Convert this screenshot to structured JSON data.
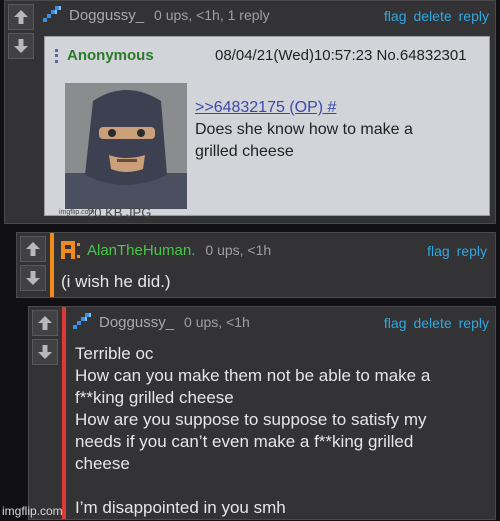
{
  "colors": {
    "background": "#111113",
    "panel": "#333335",
    "link": "#2fa8e2",
    "alan_name": "#47c74a",
    "orange_stripe": "#f18a1a",
    "red_stripe": "#e03838",
    "chan_bg": "#d2d4da"
  },
  "comments": [
    {
      "username": "Doggussy_",
      "meta": "0 ups, <1h, 1 reply",
      "actions": [
        "flag",
        "delete",
        "reply"
      ],
      "avatar_icon": "blue-pixel-avatar-icon",
      "image": {
        "poster": "Anonymous",
        "datetime": "08/04/21(Wed)10:57:23 No.64832301",
        "quote_link": ">>64832175 (OP) #",
        "reply_lines": [
          "Does she know how to make a",
          "grilled cheese"
        ],
        "file_info": "20 KB JPG",
        "watermark": "imgflip.com"
      }
    },
    {
      "username": "AlanTheHuman.",
      "meta": "0 ups, <1h",
      "actions": [
        "flag",
        "reply"
      ],
      "avatar_icon": "orange-pixel-avatar-icon",
      "text": "(i wish he did.)"
    },
    {
      "username": "Doggussy_",
      "meta": "0 ups, <1h",
      "actions": [
        "flag",
        "delete",
        "reply"
      ],
      "avatar_icon": "blue-pixel-avatar-icon",
      "text": "Terrible oc\nHow can you make them not be able to make a\nf**king grilled cheese\nHow are you suppose to suppose to satisfy my\nneeds if you can’t even make a f**king grilled\ncheese\n\nI’m disappointed in you smh"
    }
  ],
  "footer_watermark": "imgflip.com"
}
